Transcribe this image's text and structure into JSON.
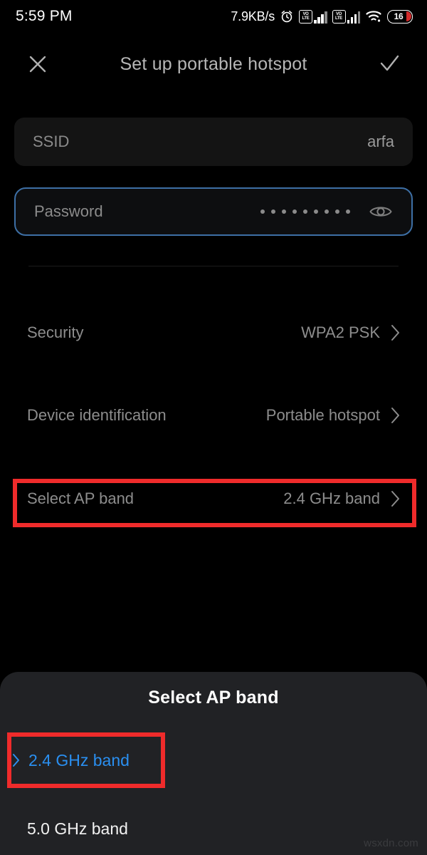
{
  "status_bar": {
    "time": "5:59 PM",
    "network_speed": "7.9KB/s",
    "alarm_icon": "alarm-clock-icon",
    "sim1_label": "VO LTE",
    "sim2_label": "VO LTE",
    "wifi_icon": "wifi-icon",
    "battery_level": "16"
  },
  "appbar": {
    "close_icon": "close-icon",
    "title": "Set up portable hotspot",
    "confirm_icon": "check-icon"
  },
  "form": {
    "ssid": {
      "label": "SSID",
      "value": "arfa"
    },
    "password": {
      "label": "Password",
      "masked_value": "•••••••••",
      "dot_count": 9,
      "toggle_icon": "eye-icon",
      "focused": true
    }
  },
  "settings_rows": [
    {
      "label": "Security",
      "value": "WPA2 PSK",
      "chevron_icon": "chevron-right-icon"
    },
    {
      "label": "Device identification",
      "value": "Portable hotspot",
      "chevron_icon": "chevron-right-icon"
    },
    {
      "label": "Select AP band",
      "value": "2.4 GHz band",
      "chevron_icon": "chevron-right-icon",
      "highlighted": true
    }
  ],
  "bottom_sheet": {
    "title": "Select AP band",
    "options": [
      {
        "label": "2.4 GHz band",
        "selected": true,
        "marker_icon": "chevron-right-icon"
      },
      {
        "label": "5.0 GHz band",
        "selected": false
      }
    ]
  },
  "annotations": {
    "color": "#ef2b2b",
    "boxes": [
      "select-ap-band-row",
      "2.4-ghz-band-option"
    ]
  },
  "watermark": {
    "text": "wsxdn.com"
  },
  "colors": {
    "background": "#000000",
    "sheet_background": "#212225",
    "accent_blue": "#2a8ff0",
    "field_focus_border": "#3d6fa5",
    "annotation_red": "#ef2b2b",
    "muted_text": "#8d8d8d"
  }
}
